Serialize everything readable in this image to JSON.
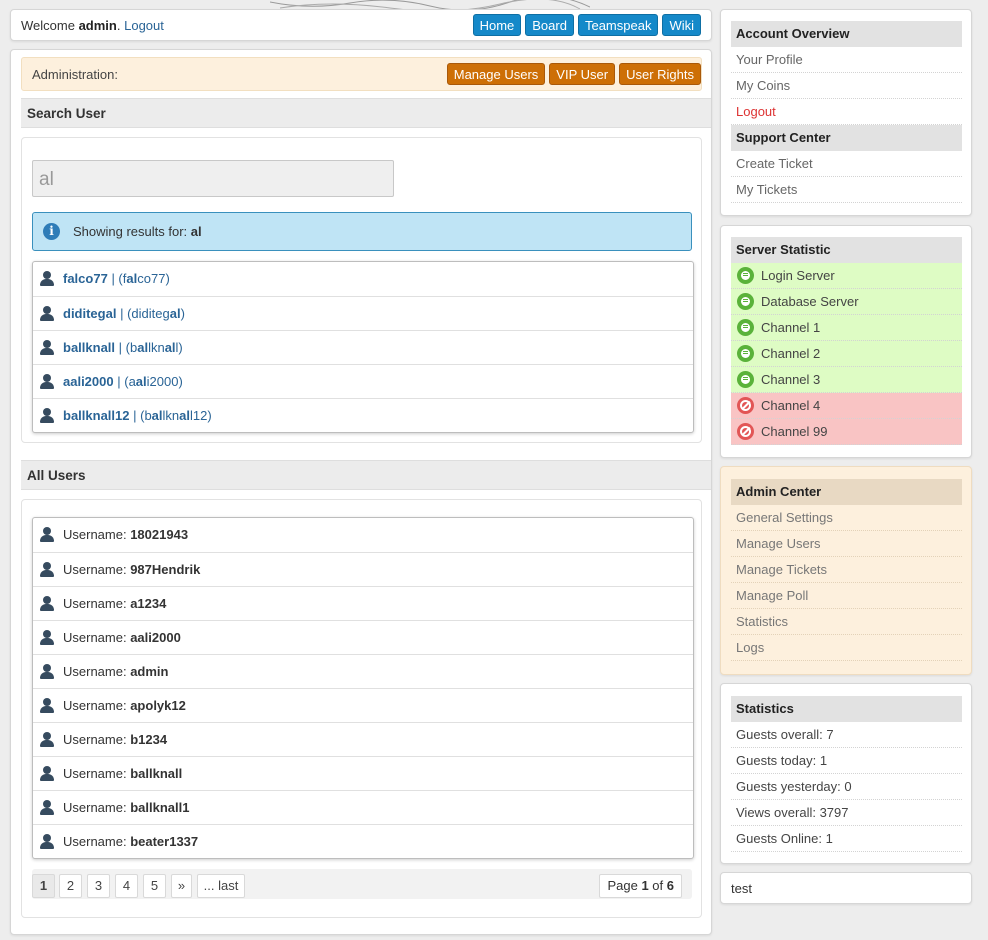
{
  "topbar": {
    "welcome_prefix": "Welcome ",
    "username": "admin",
    "welcome_suffix": ".",
    "logout": "Logout",
    "nav": [
      "Home",
      "Board",
      "Teamspeak",
      "Wiki"
    ]
  },
  "adminbar": {
    "label": "Administration:",
    "buttons": [
      "Manage Users",
      "VIP User",
      "User Rights"
    ]
  },
  "search": {
    "heading": "Search User",
    "value": "al",
    "info_prefix": "Showing results for: ",
    "info_term": "al",
    "results": [
      {
        "name": "falco77",
        "pre": "f",
        "match": "al",
        "post": "co77"
      },
      {
        "name": "diditegal",
        "pre": "diditeg",
        "match": "al",
        "post": ""
      },
      {
        "name": "ballknall",
        "pre": "b",
        "match": "al",
        "mid": "lkn",
        "match2": "al",
        "post": "l"
      },
      {
        "name": "aali2000",
        "pre": "a",
        "match": "al",
        "post": "i2000"
      },
      {
        "name": "ballknall12",
        "pre": "b",
        "match": "al",
        "mid": "lkn",
        "match2": "al",
        "post": "l12"
      }
    ]
  },
  "all_users": {
    "heading": "All Users",
    "label": "Username: ",
    "users": [
      "18021943",
      "987Hendrik",
      "a1234",
      "aali2000",
      "admin",
      "apolyk12",
      "b1234",
      "ballknall",
      "ballknall1",
      "beater1337"
    ],
    "pages": [
      "1",
      "2",
      "3",
      "4",
      "5",
      "»",
      "... last"
    ],
    "page_prefix": "Page ",
    "page_current": "1",
    "page_of": " of ",
    "page_total": "6"
  },
  "sidebar": {
    "account_title": "Account Overview",
    "account_items": [
      "Your Profile",
      "My Coins",
      "Logout"
    ],
    "support_title": "Support Center",
    "support_items": [
      "Create Ticket",
      "My Tickets"
    ],
    "server_title": "Server Statistic",
    "servers": [
      {
        "name": "Login Server",
        "status": "online"
      },
      {
        "name": "Database Server",
        "status": "online"
      },
      {
        "name": "Channel 1",
        "status": "online"
      },
      {
        "name": "Channel 2",
        "status": "online"
      },
      {
        "name": "Channel 3",
        "status": "online"
      },
      {
        "name": "Channel 4",
        "status": "offline"
      },
      {
        "name": "Channel 99",
        "status": "offline"
      }
    ],
    "admin_title": "Admin Center",
    "admin_items": [
      "General Settings",
      "Manage Users",
      "Manage Tickets",
      "Manage Poll",
      "Statistics",
      "Logs"
    ],
    "stats_title": "Statistics",
    "stats_items": [
      "Guests overall: 7",
      "Guests today: 1",
      "Guests yesterday: 0",
      "Views overall: 3797",
      "Guests Online: 1"
    ],
    "footer_text": "test"
  },
  "colors": {
    "accent_blue": "#1589c9",
    "accent_orange": "#cd6f06",
    "online_bg": "#defcc4",
    "offline_bg": "#f9c4c4"
  }
}
